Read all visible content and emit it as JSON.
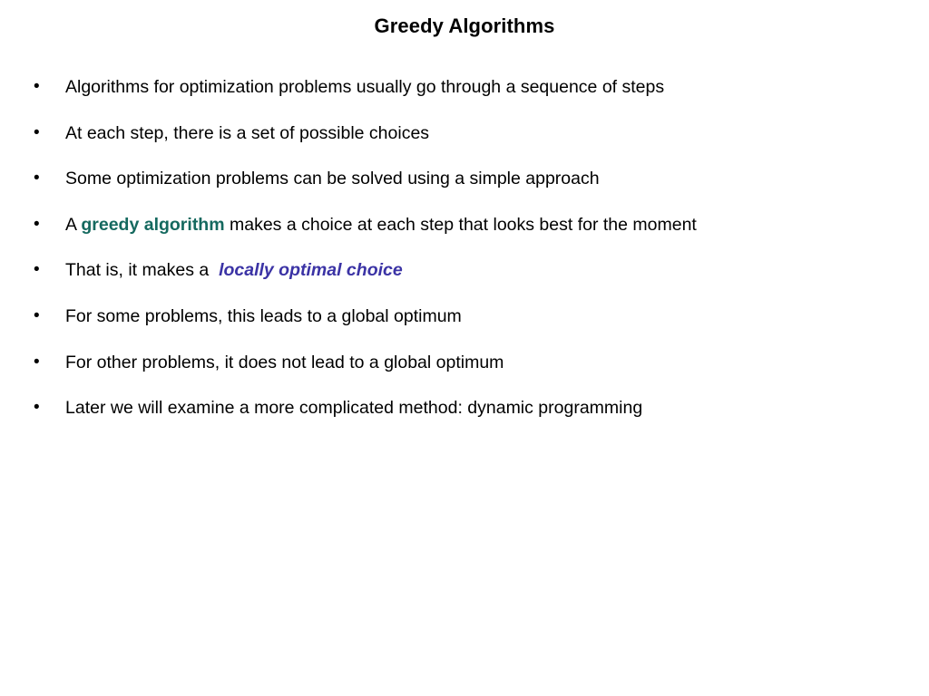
{
  "slide": {
    "title": "Greedy Algorithms",
    "bullet_marker": "•",
    "background_color": "#ffffff",
    "text_color": "#000000",
    "accent_colors": {
      "greedy_algorithm_teal": "#15695f",
      "locally_optimal_indigo": "#3b33a5"
    },
    "bullets": [
      {
        "parts": [
          {
            "text": "Algorithms for optimization problems usually go through a sequence of steps",
            "style": "plain"
          }
        ]
      },
      {
        "parts": [
          {
            "text": "At each step, there is a set of possible choices",
            "style": "plain"
          }
        ]
      },
      {
        "parts": [
          {
            "text": "Some optimization problems can be solved using a simple approach",
            "style": "plain"
          }
        ]
      },
      {
        "parts": [
          {
            "text": "A ",
            "style": "plain"
          },
          {
            "text": "greedy algorithm",
            "style": "bold-teal"
          },
          {
            "text": " makes a choice at each step that looks best for the moment",
            "style": "plain"
          }
        ]
      },
      {
        "parts": [
          {
            "text": "That is, it makes a  ",
            "style": "plain"
          },
          {
            "text": "locally optimal choice",
            "style": "bold-italic-indigo"
          }
        ]
      },
      {
        "parts": [
          {
            "text": "For some problems, this leads to a global optimum",
            "style": "plain"
          }
        ]
      },
      {
        "parts": [
          {
            "text": "For other problems, it does not lead to a global optimum",
            "style": "plain"
          }
        ]
      },
      {
        "parts": [
          {
            "text": "Later we will examine a more complicated method: dynamic programming",
            "style": "plain"
          }
        ]
      }
    ]
  }
}
